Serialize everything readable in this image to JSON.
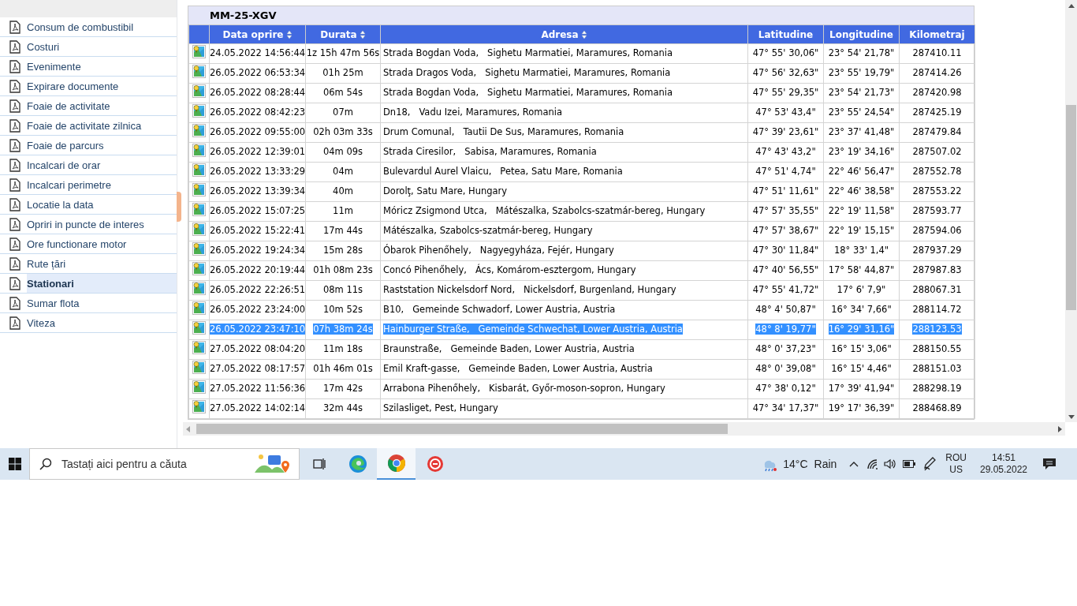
{
  "sidebar": {
    "items": [
      {
        "label": "Consum de combustibil",
        "selected": false
      },
      {
        "label": "Costuri",
        "selected": false
      },
      {
        "label": "Evenimente",
        "selected": false
      },
      {
        "label": "Expirare documente",
        "selected": false
      },
      {
        "label": "Foaie de activitate",
        "selected": false
      },
      {
        "label": "Foaie de activitate zilnica",
        "selected": false
      },
      {
        "label": "Foaie de parcurs",
        "selected": false
      },
      {
        "label": "Incalcari de orar",
        "selected": false
      },
      {
        "label": "Incalcari perimetre",
        "selected": false
      },
      {
        "label": "Locatie la data",
        "selected": false
      },
      {
        "label": "Opriri in puncte de interes",
        "selected": false
      },
      {
        "label": "Ore functionare motor",
        "selected": false
      },
      {
        "label": "Rute țări",
        "selected": false
      },
      {
        "label": "Stationari",
        "selected": true
      },
      {
        "label": "Sumar flota",
        "selected": false
      },
      {
        "label": "Viteza",
        "selected": false
      }
    ]
  },
  "table": {
    "title": "MM-25-XGV",
    "columns": [
      {
        "label": "Data oprire",
        "sortable": true
      },
      {
        "label": "Durata",
        "sortable": true
      },
      {
        "label": "Adresa",
        "sortable": true
      },
      {
        "label": "Latitudine",
        "sortable": false
      },
      {
        "label": "Longitudine",
        "sortable": false
      },
      {
        "label": "Kilometraj",
        "sortable": false
      }
    ],
    "rows": [
      {
        "selected": false,
        "cells": [
          "24.05.2022 14:56:44",
          "1z 15h 47m 56s",
          "Strada Bogdan Voda,   Sighetu Marmatiei, Maramures, Romania",
          "47° 55' 30,06\"",
          "23° 54' 21,78\"",
          "287410.11"
        ]
      },
      {
        "selected": false,
        "cells": [
          "26.05.2022 06:53:34",
          "01h 25m",
          "Strada Dragos Voda,   Sighetu Marmatiei, Maramures, Romania",
          "47° 56' 32,63\"",
          "23° 55' 19,79\"",
          "287414.26"
        ]
      },
      {
        "selected": false,
        "cells": [
          "26.05.2022 08:28:44",
          "06m 54s",
          "Strada Bogdan Voda,   Sighetu Marmatiei, Maramures, Romania",
          "47° 55' 29,35\"",
          "23° 54' 21,73\"",
          "287420.98"
        ]
      },
      {
        "selected": false,
        "cells": [
          "26.05.2022 08:42:23",
          "07m",
          "Dn18,   Vadu Izei, Maramures, Romania",
          "47° 53' 43,4\"",
          "23° 55' 24,54\"",
          "287425.19"
        ]
      },
      {
        "selected": false,
        "cells": [
          "26.05.2022 09:55:00",
          "02h 03m 33s",
          "Drum Comunal,   Tautii De Sus, Maramures, Romania",
          "47° 39' 23,61\"",
          "23° 37' 41,48\"",
          "287479.84"
        ]
      },
      {
        "selected": false,
        "cells": [
          "26.05.2022 12:39:01",
          "04m 09s",
          "Strada Ciresilor,   Sabisa, Maramures, Romania",
          "47° 43' 43,2\"",
          "23° 19' 34,16\"",
          "287507.02"
        ]
      },
      {
        "selected": false,
        "cells": [
          "26.05.2022 13:33:29",
          "04m",
          "Bulevardul Aurel Vlaicu,   Petea, Satu Mare, Romania",
          "47° 51' 4,74\"",
          "22° 46' 56,47\"",
          "287552.78"
        ]
      },
      {
        "selected": false,
        "cells": [
          "26.05.2022 13:39:34",
          "40m",
          "Dorolţ, Satu Mare, Hungary",
          "47° 51' 11,61\"",
          "22° 46' 38,58\"",
          "287553.22"
        ]
      },
      {
        "selected": false,
        "cells": [
          "26.05.2022 15:07:25",
          "11m",
          "Móricz Zsigmond Utca,   Mátészalka, Szabolcs-szatmár-bereg, Hungary",
          "47° 57' 35,55\"",
          "22° 19' 11,58\"",
          "287593.77"
        ]
      },
      {
        "selected": false,
        "cells": [
          "26.05.2022 15:22:41",
          "17m 44s",
          "Mátészalka, Szabolcs-szatmár-bereg, Hungary",
          "47° 57' 38,67\"",
          "22° 19' 15,15\"",
          "287594.06"
        ]
      },
      {
        "selected": false,
        "cells": [
          "26.05.2022 19:24:34",
          "15m 28s",
          "Óbarok Pihenőhely,   Nagyegyháza, Fejér, Hungary",
          "47° 30' 11,84\"",
          "18° 33' 1,4\"",
          "287937.29"
        ]
      },
      {
        "selected": false,
        "cells": [
          "26.05.2022 20:19:44",
          "01h 08m 23s",
          "Concó Pihenőhely,   Ács, Komárom-esztergom, Hungary",
          "47° 40' 56,55\"",
          "17° 58' 44,87\"",
          "287987.83"
        ]
      },
      {
        "selected": false,
        "cells": [
          "26.05.2022 22:26:51",
          "08m 11s",
          "Raststation Nickelsdorf Nord,   Nickelsdorf, Burgenland, Hungary",
          "47° 55' 41,72\"",
          "17° 6' 7,9\"",
          "288067.31"
        ]
      },
      {
        "selected": false,
        "cells": [
          "26.05.2022 23:24:00",
          "10m 52s",
          "B10,   Gemeinde Schwadorf, Lower Austria, Austria",
          "48° 4' 50,87\"",
          "16° 34' 7,66\"",
          "288114.72"
        ]
      },
      {
        "selected": true,
        "cells": [
          "26.05.2022 23:47:10",
          "07h 38m 24s",
          "Hainburger Straße,   Gemeinde Schwechat, Lower Austria, Austria",
          "48° 8' 19,77\"",
          "16° 29' 31,16\"",
          "288123.53"
        ]
      },
      {
        "selected": false,
        "cells": [
          "27.05.2022 08:04:20",
          "11m 18s",
          "Braunstraße,   Gemeinde Baden, Lower Austria, Austria",
          "48° 0' 37,23\"",
          "16° 15' 3,06\"",
          "288150.55"
        ]
      },
      {
        "selected": false,
        "cells": [
          "27.05.2022 08:17:57",
          "01h 46m 01s",
          "Emil Kraft-gasse,   Gemeinde Baden, Lower Austria, Austria",
          "48° 0' 39,08\"",
          "16° 15' 4,46\"",
          "288151.03"
        ]
      },
      {
        "selected": false,
        "cells": [
          "27.05.2022 11:56:36",
          "17m 42s",
          "Arrabona Pihenőhely,   Kisbarát, Győr-moson-sopron, Hungary",
          "47° 38' 0,12\"",
          "17° 39' 41,94\"",
          "288298.19"
        ]
      },
      {
        "selected": false,
        "cells": [
          "27.05.2022 14:02:14",
          "32m 44s",
          "Szilasliget, Pest, Hungary",
          "47° 34' 17,37\"",
          "19° 17' 36,39\"",
          "288468.89"
        ]
      }
    ]
  },
  "taskbar": {
    "search": {
      "placeholder": "Tastați aici pentru a căuta"
    },
    "apps": [
      {
        "kind": "taskview",
        "selected": false
      },
      {
        "kind": "edge",
        "selected": false
      },
      {
        "kind": "chrome",
        "selected": true
      },
      {
        "kind": "app",
        "selected": false
      }
    ],
    "weather": {
      "temperature": "14°C",
      "condition": "Rain"
    },
    "language": {
      "primary": "ROU",
      "secondary": "US"
    },
    "clock": {
      "time": "14:51",
      "date": "29.05.2022"
    }
  }
}
